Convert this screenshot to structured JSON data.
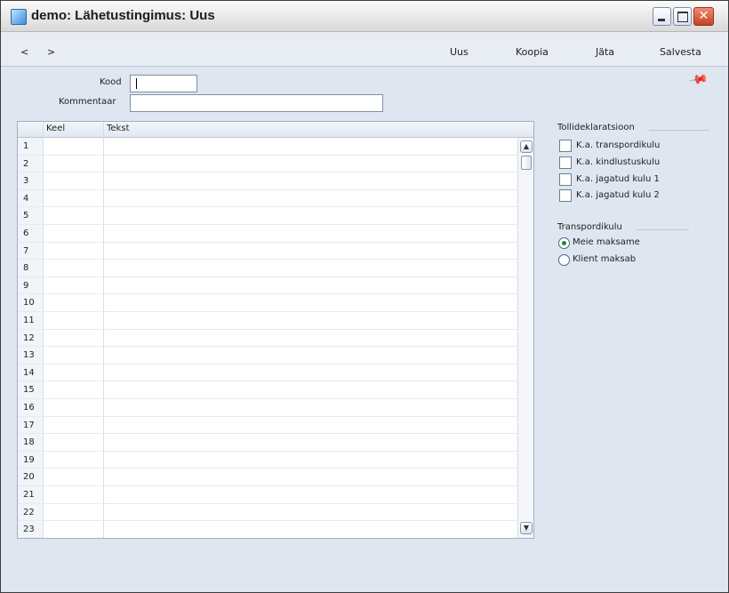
{
  "window": {
    "title": "demo: Lähetustingimus: Uus"
  },
  "toolbar": {
    "prev": "<",
    "next": ">",
    "new": "Uus",
    "copy": "Koopia",
    "cancel": "Jäta",
    "save": "Salvesta"
  },
  "form": {
    "code_label": "Kood",
    "code_value": "",
    "comment_label": "Kommentaar",
    "comment_value": ""
  },
  "grid": {
    "headers": [
      "Keel",
      "Tekst"
    ],
    "rows": [
      "1",
      "2",
      "3",
      "4",
      "5",
      "6",
      "7",
      "8",
      "9",
      "10",
      "11",
      "12",
      "13",
      "14",
      "15",
      "16",
      "17",
      "18",
      "19",
      "20",
      "21",
      "22",
      "23"
    ]
  },
  "customs": {
    "title": "Tollideklaratsioon",
    "options": [
      "K.a. transpordikulu",
      "K.a. kindlustuskulu",
      "K.a. jagatud kulu 1",
      "K.a. jagatud kulu 2"
    ]
  },
  "transport": {
    "title": "Transpordikulu",
    "options": [
      "Meie maksame",
      "Klient maksab"
    ],
    "selected": "Meie maksame"
  },
  "icons": [
    "app-icon",
    "minimize-icon",
    "maximize-icon",
    "close-icon",
    "pin-icon",
    "scroll-up-icon",
    "scroll-down-icon"
  ]
}
